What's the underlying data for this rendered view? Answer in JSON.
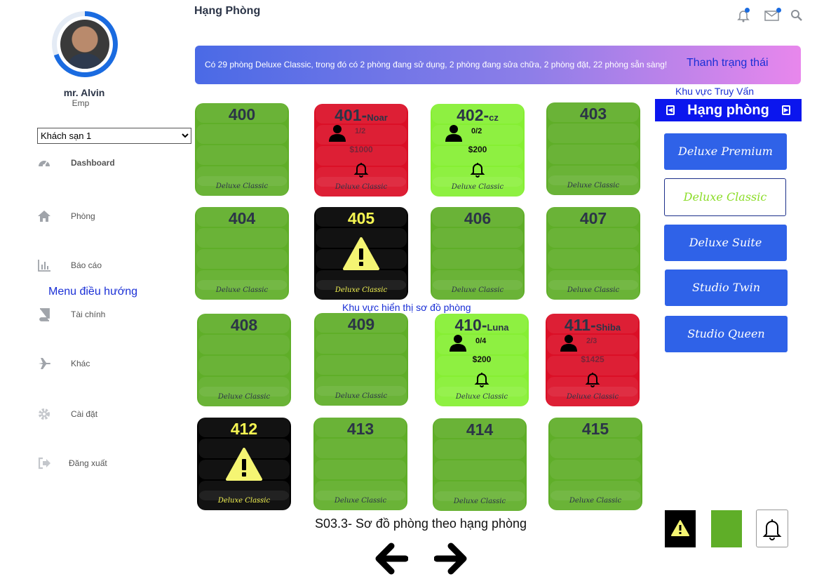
{
  "user": {
    "name": "mr. Alvin",
    "role": "Emp"
  },
  "hotel_select": {
    "selected": "Khách sạn 1"
  },
  "nav": [
    {
      "label": "Dashboard",
      "icon": "dashboard-icon"
    },
    {
      "label": "Phòng",
      "icon": "home-icon"
    },
    {
      "label": "Báo cáo",
      "icon": "report-chart-icon"
    },
    {
      "label": "Tài chính",
      "icon": "book-icon"
    },
    {
      "label": "Khác",
      "icon": "plane-icon"
    },
    {
      "label": "Cài đặt",
      "icon": "gear-icon"
    },
    {
      "label": "Đăng xuất",
      "icon": "logout-icon"
    }
  ],
  "annotations": {
    "menu": "Menu điều hướng",
    "status": "Thanh trạng thái",
    "query": "Khu vực Truy Vấn",
    "map": "Khu vực hiển thị sơ đồ phòng",
    "caption": "S03.3- Sơ đồ phòng theo hạng phòng"
  },
  "header": {
    "title": "Hạng Phòng"
  },
  "status_bar": {
    "text": "Có 29 phòng Deluxe Classic, trong đó có 2 phòng đang sử dụng, 2 phòng đang sửa chữa, 2 phòng đặt, 22 phòng sẵn sàng!"
  },
  "rooms": [
    {
      "number": "400",
      "category": "Deluxe Classic"
    },
    {
      "number": "401",
      "guest": "Noar",
      "occupancy": "1/2",
      "price": "$1000",
      "category": "Deluxe Classic"
    },
    {
      "number": "402",
      "guest": "cz",
      "occupancy": "0/2",
      "price": "$200",
      "category": "Deluxe Classic"
    },
    {
      "number": "403",
      "category": "Deluxe Classic"
    },
    {
      "number": "404",
      "category": "Deluxe Classic"
    },
    {
      "number": "405",
      "category": "Deluxe Classic"
    },
    {
      "number": "406",
      "category": "Deluxe Classic"
    },
    {
      "number": "407",
      "category": "Deluxe Classic"
    },
    {
      "number": "408",
      "category": "Deluxe Classic"
    },
    {
      "number": "409",
      "category": "Deluxe Classic"
    },
    {
      "number": "410",
      "guest": "Luna",
      "occupancy": "0/4",
      "price": "$200",
      "category": "Deluxe Classic"
    },
    {
      "number": "411",
      "guest": "Shiba",
      "occupancy": "2/3",
      "price": "$1425",
      "category": "Deluxe Classic"
    },
    {
      "number": "412",
      "category": "Deluxe Classic"
    },
    {
      "number": "413",
      "category": "Deluxe Classic"
    },
    {
      "number": "414",
      "category": "Deluxe Classic"
    },
    {
      "number": "415",
      "category": "Deluxe Classic"
    }
  ],
  "category_panel": {
    "title": "Hạng phòng",
    "items": [
      "Deluxe Premium",
      "Deluxe Classic",
      "Deluxe Suite",
      "Studio Twin",
      "Studio Queen"
    ]
  },
  "colors": {
    "available": "#5fae28",
    "booked": "#86ef33",
    "occupied": "#db0f26",
    "maintenance": "#000000",
    "accent": "#2f62e8"
  }
}
